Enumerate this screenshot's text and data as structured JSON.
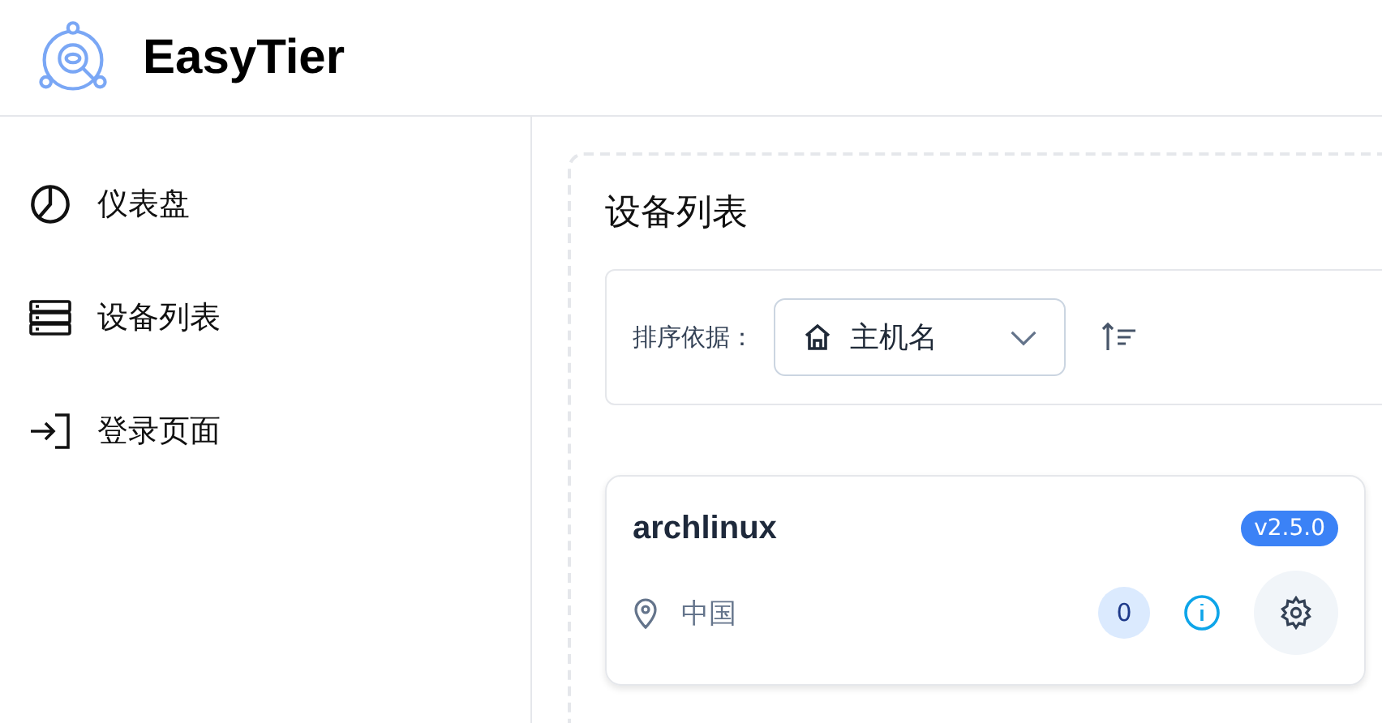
{
  "app": {
    "title": "EasyTier"
  },
  "sidebar": {
    "items": [
      {
        "label": "仪表盘",
        "kind": "dashboard",
        "selected": false
      },
      {
        "label": "设备列表",
        "kind": "devices",
        "selected": false
      },
      {
        "label": "登录页面",
        "kind": "login",
        "selected": false
      }
    ]
  },
  "page": {
    "title": "设备列表",
    "sort": {
      "label": "排序依据：",
      "value": "主机名"
    },
    "devices": [
      {
        "hostname": "archlinux",
        "version": "v2.5.0",
        "location": "中国",
        "count": "0"
      }
    ]
  }
}
